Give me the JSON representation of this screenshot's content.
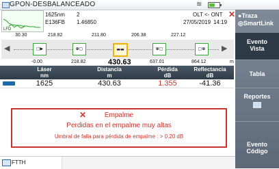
{
  "app": {
    "title": "GPON-DESBALANCEADO"
  },
  "header": {
    "wavelength": "1625nm",
    "pulse": "2",
    "module": "E136FB",
    "index": "1.46850",
    "direction": "OLT <- ONT",
    "date": "27/05/2019",
    "time": "14:19",
    "thumb_label": "LFD"
  },
  "scale": {
    "top": [
      "30.30",
      "218.82",
      "211.80",
      "206.38",
      "227.12"
    ]
  },
  "events": [
    {
      "icon": "launch-event",
      "glyph": "▢▶"
    },
    {
      "icon": "connector-event",
      "glyph": "⊕▢"
    },
    {
      "icon": "splice-event",
      "glyph": "▬▬"
    },
    {
      "icon": "connector-event",
      "glyph": "⊕▢"
    },
    {
      "icon": "end-event",
      "glyph": "▢⊕"
    }
  ],
  "distances": [
    "-0.00",
    "218.82",
    "430.63",
    "637.01",
    "864.12"
  ],
  "table": {
    "headers": [
      {
        "top": "Láser",
        "bottom": "nm"
      },
      {
        "top": "Distancia",
        "bottom": "m"
      },
      {
        "top": "Pérdida",
        "bottom": "dB"
      },
      {
        "top": "Reflectancia",
        "bottom": "dB"
      }
    ],
    "row": {
      "laser": "1625",
      "distance": "430.63",
      "loss": "1.355",
      "reflectance": "-41.36"
    }
  },
  "alert": {
    "title": "Empalme",
    "message": "Perdidas en el empalme muy altas",
    "detail": "Umbral de falla para pérdida de empalme : > 0.20 dB"
  },
  "bottom": {
    "label": "FTTH"
  },
  "right_panel": {
    "traza": "Traza",
    "smartlink": "SmartLink",
    "evento_vista": [
      "Evento",
      "Vista"
    ],
    "tabla": "Tabla",
    "reportes": "Reportes",
    "evento_codigo": [
      "Evento",
      "Código"
    ]
  },
  "colors": {
    "alert": "#c8342b",
    "accent": "#1e6aa8",
    "selected": "#f0b400"
  }
}
